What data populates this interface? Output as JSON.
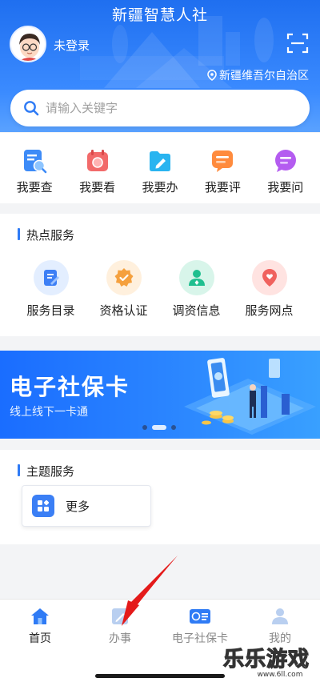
{
  "header": {
    "title": "新疆智慧人社",
    "login_text": "未登录",
    "location": "新疆维吾尔自治区"
  },
  "search": {
    "placeholder": "请输入关键字"
  },
  "quick_actions": [
    {
      "label": "我要查",
      "icon": "search-doc-icon",
      "color": "#3d8bf7"
    },
    {
      "label": "我要看",
      "icon": "calendar-icon",
      "color": "#f26a6a"
    },
    {
      "label": "我要办",
      "icon": "folder-edit-icon",
      "color": "#29b4f0"
    },
    {
      "label": "我要评",
      "icon": "comment-icon",
      "color": "#ff8b3d"
    },
    {
      "label": "我要问",
      "icon": "chat-icon",
      "color": "#b45cf0"
    }
  ],
  "hot_services": {
    "title": "热点服务",
    "items": [
      {
        "label": "服务目录",
        "icon": "catalog-icon",
        "color": "#3d7ff5"
      },
      {
        "label": "资格认证",
        "icon": "certification-badge-icon",
        "color": "#f5a03d"
      },
      {
        "label": "调资信息",
        "icon": "user-info-icon",
        "color": "#1fbf8f"
      },
      {
        "label": "服务网点",
        "icon": "location-heart-icon",
        "color": "#f0625e"
      }
    ]
  },
  "banner": {
    "title": "电子社保卡",
    "subtitle": "线上线下一卡通",
    "slide_count": 3,
    "active_slide": 2
  },
  "theme_services": {
    "title": "主题服务",
    "more_label": "更多"
  },
  "tabbar": {
    "tabs": [
      {
        "label": "首页",
        "icon": "home-icon",
        "active": true
      },
      {
        "label": "办事",
        "icon": "edit-icon",
        "active": false
      },
      {
        "label": "电子社保卡",
        "icon": "card-icon",
        "active": false
      },
      {
        "label": "我的",
        "icon": "user-icon",
        "active": false
      }
    ]
  },
  "watermark": {
    "text": "乐乐游戏",
    "site": "www.6ll.com"
  },
  "colors": {
    "primary": "#2f7bf5",
    "header_gradient_top": "#1f6ff0",
    "header_gradient_bottom": "#5aa2ff"
  }
}
